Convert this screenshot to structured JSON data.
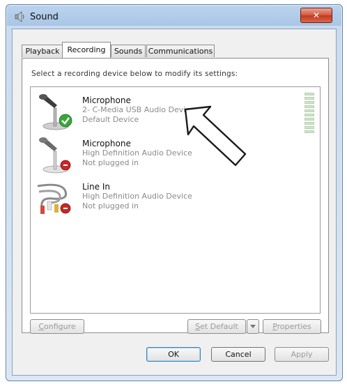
{
  "window": {
    "title": "Sound",
    "close_glyph": "✕"
  },
  "tabs": [
    {
      "label": "Playback",
      "active": false
    },
    {
      "label": "Recording",
      "active": true
    },
    {
      "label": "Sounds",
      "active": false
    },
    {
      "label": "Communications",
      "active": false
    }
  ],
  "instruction": "Select a recording device below to modify its settings:",
  "devices": [
    {
      "name": "Microphone",
      "driver": "2- C-Media USB Audio Device",
      "status": "Default Device",
      "icon": "microphone-icon",
      "badge": "default-check-icon"
    },
    {
      "name": "Microphone",
      "driver": "High Definition Audio Device",
      "status": "Not plugged in",
      "icon": "microphone-icon",
      "badge": "unplugged-icon"
    },
    {
      "name": "Line In",
      "driver": "High Definition Audio Device",
      "status": "Not plugged in",
      "icon": "line-in-cables-icon",
      "badge": "unplugged-icon"
    }
  ],
  "buttons": {
    "configure": {
      "mnemonic": "C",
      "rest": "onfigure"
    },
    "set_default": {
      "mnemonic": "S",
      "rest": "et Default"
    },
    "properties": {
      "mnemonic": "P",
      "rest": "roperties"
    },
    "ok": "OK",
    "cancel": "Cancel",
    "apply": "Apply"
  },
  "colors": {
    "titlebar": "#a9c6e6",
    "close_button": "#c13a20",
    "default_check": "#3aa53a",
    "unplugged_badge": "#c62828"
  }
}
